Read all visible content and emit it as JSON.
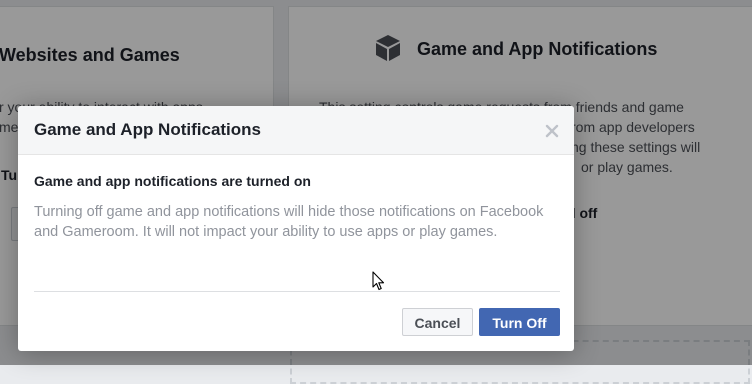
{
  "background": {
    "left_card": {
      "title": "Websites and Games",
      "description_lines": [
        "r your ability to interact with apps",
        "mes"
      ],
      "status_fragment": "Tu"
    },
    "right_card": {
      "title": "Game and App Notifications",
      "icon": "cube-icon",
      "description_lines": [
        "This setting controls game requests from friends and game",
        "rom app developers",
        "ng these settings will",
        "or play games."
      ],
      "status_fragment": "d off"
    }
  },
  "dialog": {
    "title": "Game and App Notifications",
    "close_icon": "close-icon",
    "heading": "Game and app notifications are turned on",
    "body": "Turning off game and app notifications will hide those notifications on Facebook and Gameroom. It will not impact your ability to use apps or play games.",
    "buttons": {
      "cancel": "Cancel",
      "turn_off": "Turn Off"
    }
  },
  "colors": {
    "primary_button": "#4267b2",
    "overlay": "rgba(0,0,0,0.40)",
    "body_text": "#90949c",
    "title_text": "#1d2129"
  }
}
